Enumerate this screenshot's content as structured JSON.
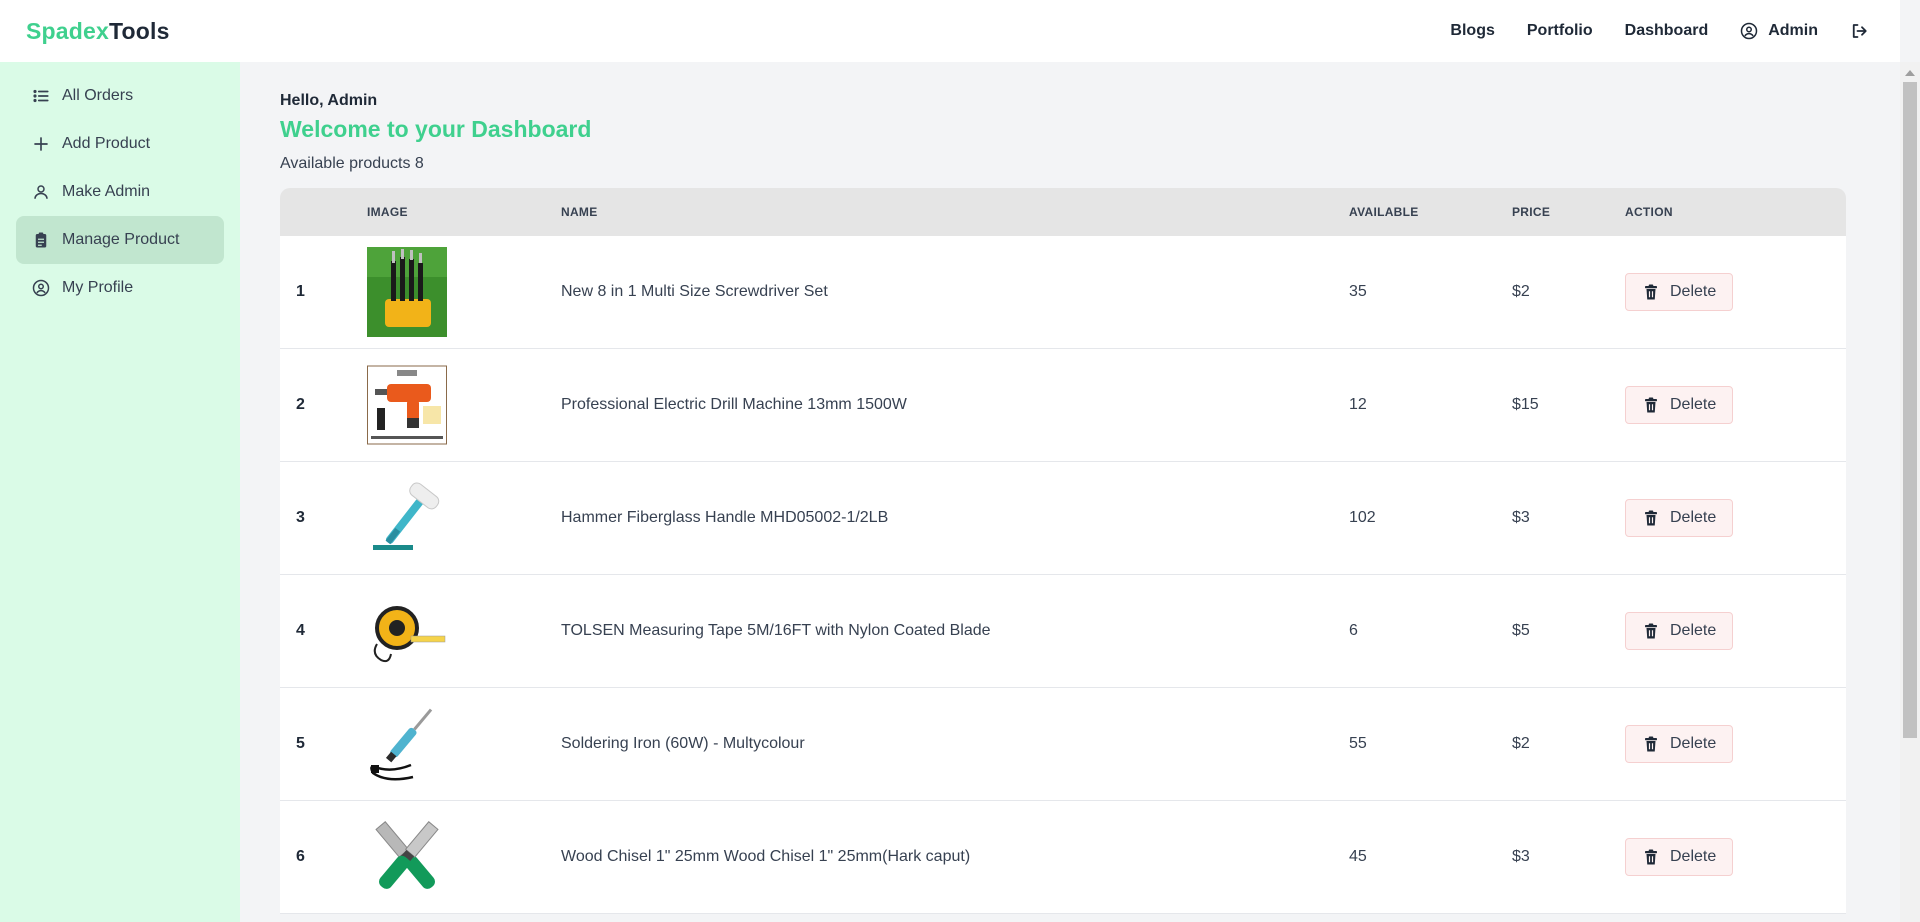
{
  "brand": {
    "part1": "Spadex",
    "part2": "Tools"
  },
  "nav": {
    "blogs": "Blogs",
    "portfolio": "Portfolio",
    "dashboard": "Dashboard",
    "admin": "Admin"
  },
  "sidebar": {
    "items": [
      {
        "label": "All Orders",
        "icon": "list-icon"
      },
      {
        "label": "Add Product",
        "icon": "plus-icon"
      },
      {
        "label": "Make Admin",
        "icon": "user-icon"
      },
      {
        "label": "Manage Product",
        "icon": "clipboard-icon",
        "active": true
      },
      {
        "label": "My Profile",
        "icon": "user-circle-icon"
      }
    ]
  },
  "main": {
    "hello": "Hello, Admin",
    "welcome": "Welcome to your Dashboard",
    "available_label": "Available products 8"
  },
  "table": {
    "headers": {
      "num": "",
      "image": "IMAGE",
      "name": "NAME",
      "available": "AVAILABLE",
      "price": "PRICE",
      "action": "ACTION"
    },
    "delete_label": "Delete",
    "rows": [
      {
        "num": "1",
        "name": "New 8 in 1 Multi Size Screwdriver Set",
        "available": "35",
        "price": "$2",
        "image": "screwdriver-set-image"
      },
      {
        "num": "2",
        "name": "Professional Electric Drill Machine 13mm 1500W",
        "available": "12",
        "price": "$15",
        "image": "drill-machine-image"
      },
      {
        "num": "3",
        "name": "Hammer Fiberglass Handle MHD05002-1/2LB",
        "available": "102",
        "price": "$3",
        "image": "hammer-image"
      },
      {
        "num": "4",
        "name": "TOLSEN Measuring Tape 5M/16FT with Nylon Coated Blade",
        "available": "6",
        "price": "$5",
        "image": "measuring-tape-image"
      },
      {
        "num": "5",
        "name": "Soldering Iron (60W) - Multycolour",
        "available": "55",
        "price": "$2",
        "image": "soldering-iron-image"
      },
      {
        "num": "6",
        "name": "Wood Chisel 1\" 25mm Wood Chisel 1\" 25mm(Hark caput)",
        "available": "45",
        "price": "$3",
        "image": "wood-chisel-image"
      }
    ]
  },
  "colors": {
    "accent": "#3fd08e",
    "sidebar_bg": "#dafbe7",
    "sidebar_active": "#c1e6cf",
    "delete_bg": "#fdf2f2"
  }
}
